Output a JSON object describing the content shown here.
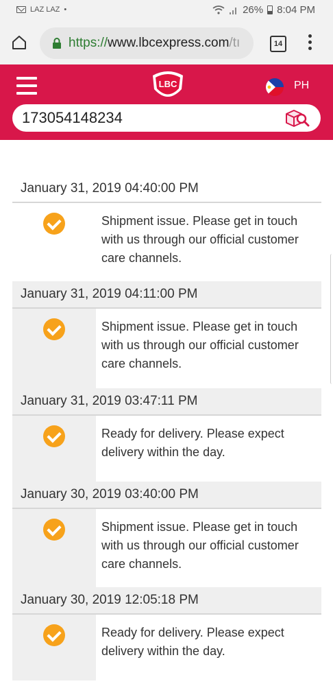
{
  "status_bar": {
    "notification": "LAZ LAZ",
    "battery": "26%",
    "time": "8:04 PM"
  },
  "browser": {
    "url_scheme": "https://",
    "url_host": "www.lbcexpress.com",
    "url_tail": "/tı",
    "tab_count": "14"
  },
  "header": {
    "logo_text": "LBC",
    "country": "PH",
    "tracking_number": "173054148234",
    "brand_color": "#d8174a"
  },
  "timeline": [
    {
      "date": "January 31, 2019 04:40:00 PM",
      "status": "Shipment issue. Please get in touch with us through our official customer care channels."
    },
    {
      "date": "January 31, 2019 04:11:00 PM",
      "status": "Shipment issue. Please get in touch with us through our official customer care channels."
    },
    {
      "date": "January 31, 2019 03:47:11 PM",
      "status": "Ready for delivery. Please expect delivery within the day."
    },
    {
      "date": "January 30, 2019 03:40:00 PM",
      "status": "Shipment issue. Please get in touch with us through our official customer care channels."
    },
    {
      "date": "January 30, 2019 12:05:18 PM",
      "status": "Ready for delivery. Please expect delivery within the day."
    }
  ]
}
